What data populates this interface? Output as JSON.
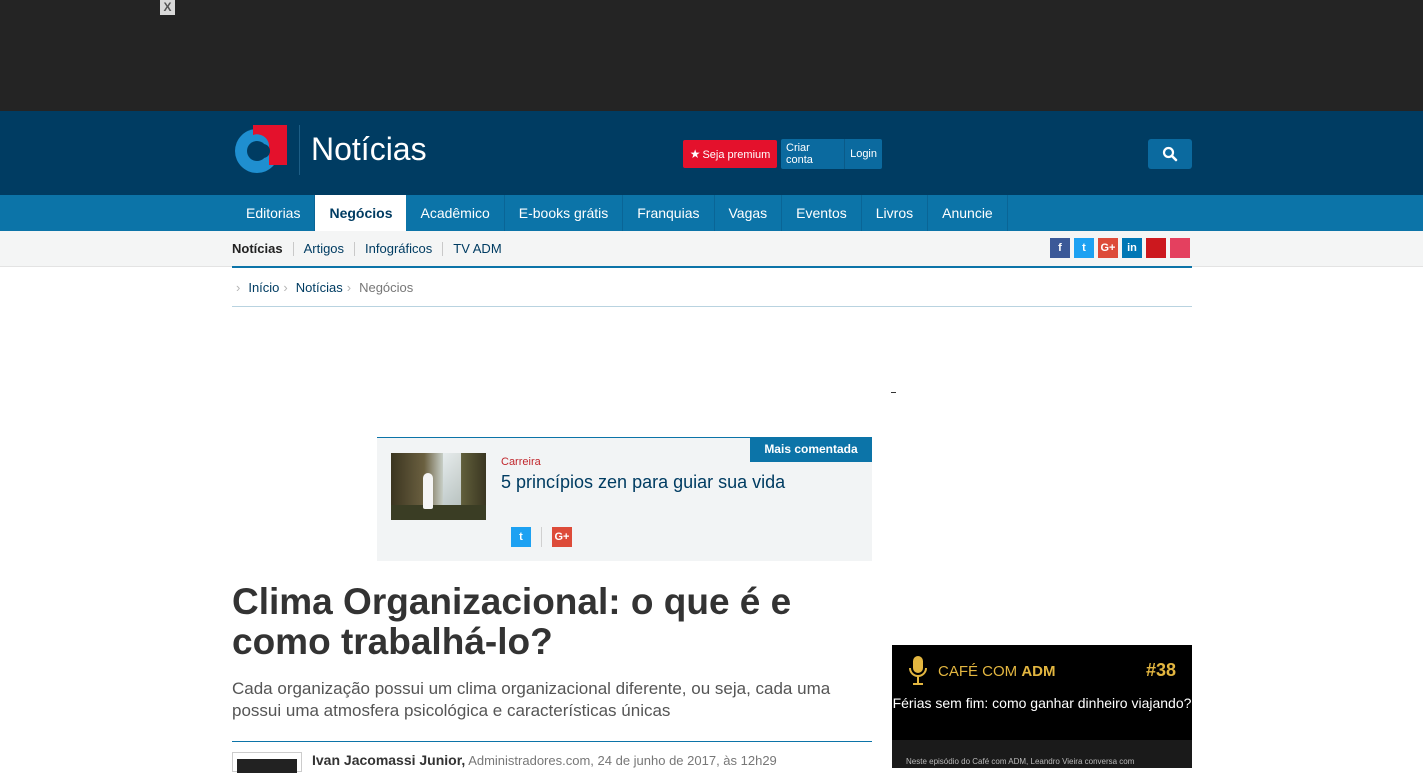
{
  "topad": {
    "close_label": "X"
  },
  "header": {
    "site_title": "Notícias",
    "premium_label": "Seja premium",
    "create_account_label": "Criar conta",
    "login_label": "Login"
  },
  "mainnav": {
    "items": [
      {
        "label": "Editorias"
      },
      {
        "label": "Negócios"
      },
      {
        "label": "Acadêmico"
      },
      {
        "label": "E-books grátis"
      },
      {
        "label": "Franquias"
      },
      {
        "label": "Vagas"
      },
      {
        "label": "Eventos"
      },
      {
        "label": "Livros"
      },
      {
        "label": "Anuncie"
      }
    ],
    "active": "Negócios"
  },
  "subnav": {
    "items": [
      {
        "label": "Notícias"
      },
      {
        "label": "Artigos"
      },
      {
        "label": "Infográficos"
      },
      {
        "label": "TV ADM"
      }
    ],
    "social": [
      {
        "name": "facebook",
        "glyph": "f",
        "color": "#3b5998"
      },
      {
        "name": "twitter",
        "glyph": "t",
        "color": "#1da1f2"
      },
      {
        "name": "google-plus",
        "glyph": "G+",
        "color": "#dd4b39"
      },
      {
        "name": "linkedin",
        "glyph": "in",
        "color": "#0077b5"
      },
      {
        "name": "youtube",
        "glyph": "",
        "color": "#cc181e"
      },
      {
        "name": "instagram",
        "glyph": "",
        "color": "#e4405f"
      }
    ]
  },
  "breadcrumb": {
    "items": [
      "Início",
      "Notícias",
      "Negócios"
    ]
  },
  "most_commented": {
    "tag": "Mais comentada",
    "category": "Carreira",
    "title": "5 princípios zen para guiar sua vida",
    "share": [
      {
        "name": "twitter",
        "glyph": "t",
        "color": "#1da1f2"
      },
      {
        "name": "google-plus",
        "glyph": "G+",
        "color": "#dd4b39"
      }
    ]
  },
  "article": {
    "headline": "Clima Organizacional: o que é e como trabalhá-lo?",
    "subhead": "Cada organização possui um clima organizacional diferente, ou seja, cada uma possui uma atmosfera psicológica e características únicas",
    "author": "Ivan Jacomassi Junior,",
    "meta": " Administradores.com, 24 de junho de 2017, às 12h29"
  },
  "cafe": {
    "brand_a": "CAFÉ COM ",
    "brand_b": "ADM",
    "episode": "#38",
    "title": "Férias sem fim: como ganhar dinheiro viajando?",
    "description": "Neste episódio do Café com ADM, Leandro Vieira conversa com"
  },
  "colors": {
    "header_bg": "#003c62",
    "nav_bg": "#0c74a8",
    "premium": "#e4112c",
    "cafe_gold": "#e3b640"
  }
}
